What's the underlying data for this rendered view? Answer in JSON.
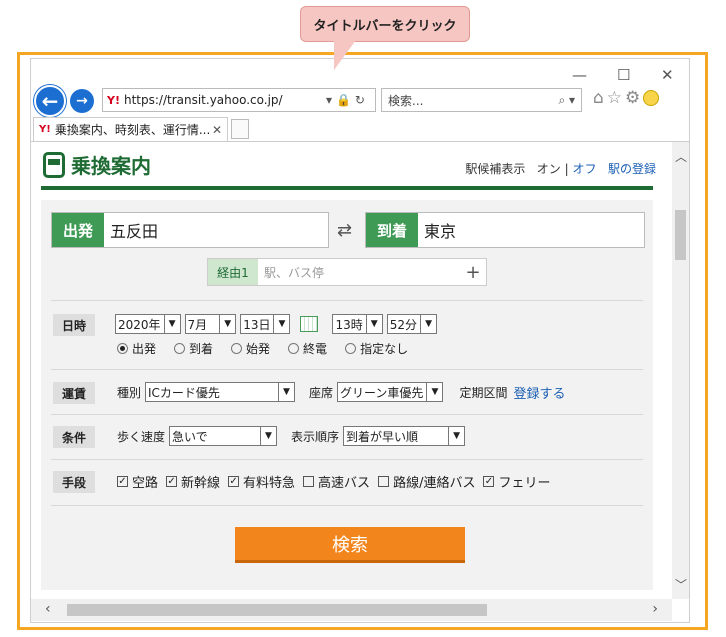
{
  "callout": "タイトルバーをクリック",
  "window": {
    "minimize": "—",
    "maximize": "☐",
    "close": "✕"
  },
  "browser": {
    "url": "https://transit.yahoo.co.jp/",
    "url_logo": "Y!",
    "search_placeholder": "検索...",
    "tab_title": "乗換案内、時刻表、運行情...",
    "tab_logo": "Y!"
  },
  "site": {
    "logo": "乗換案内",
    "station_suggest": "駅候補表示",
    "on": "オン",
    "sep": "|",
    "off": "オフ",
    "register_station": "駅の登録"
  },
  "route": {
    "from_label": "出発",
    "from_value": "五反田",
    "to_label": "到着",
    "to_value": "東京",
    "via_label": "経由1",
    "via_placeholder": "駅、バス停"
  },
  "datetime": {
    "label": "日時",
    "year": "2020年",
    "month": "7月",
    "day": "13日",
    "hour": "13時",
    "minute": "52分",
    "options": [
      "出発",
      "到着",
      "始発",
      "終電",
      "指定なし"
    ],
    "selected": "出発"
  },
  "fare": {
    "label": "運賃",
    "type_label": "種別",
    "type_value": "ICカード優先",
    "seat_label": "座席",
    "seat_value": "グリーン車優先",
    "commuter_label": "定期区間",
    "commuter_link": "登録する"
  },
  "conditions": {
    "label": "条件",
    "speed_label": "歩く速度",
    "speed_value": "急いで",
    "order_label": "表示順序",
    "order_value": "到着が早い順"
  },
  "means": {
    "label": "手段",
    "items": [
      {
        "name": "空路",
        "checked": true
      },
      {
        "name": "新幹線",
        "checked": true
      },
      {
        "name": "有料特急",
        "checked": true
      },
      {
        "name": "高速バス",
        "checked": false
      },
      {
        "name": "路線/連絡バス",
        "checked": false
      },
      {
        "name": "フェリー",
        "checked": true
      }
    ]
  },
  "search_button": "検索"
}
